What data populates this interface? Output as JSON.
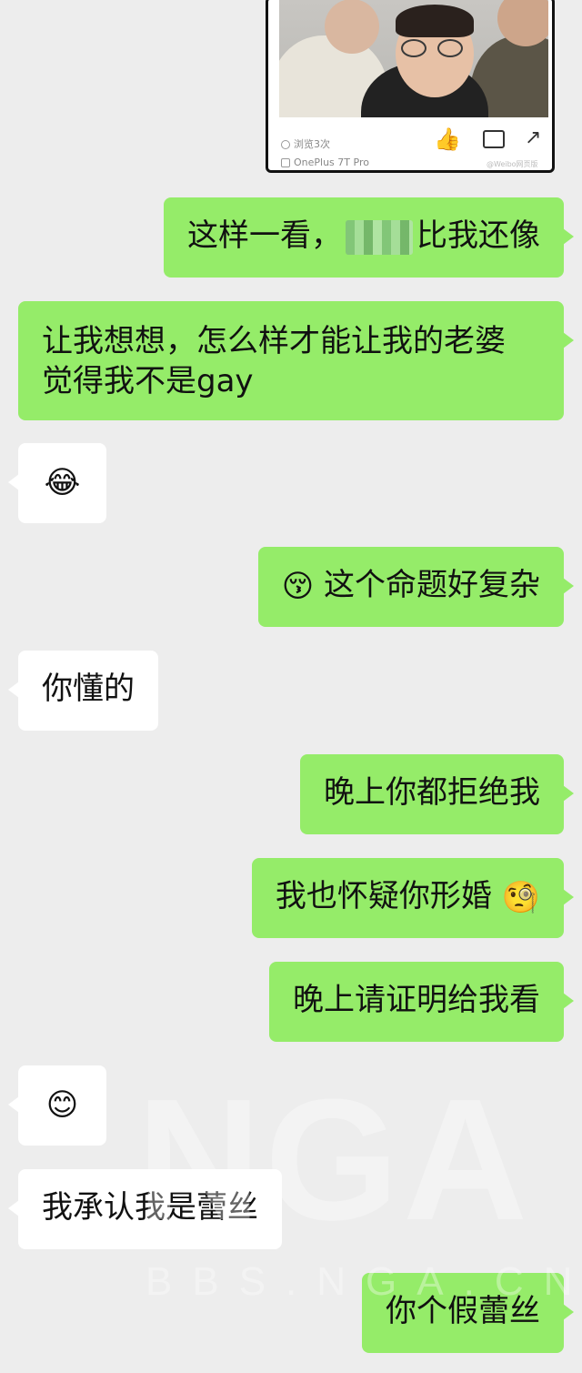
{
  "shared_card": {
    "views_text": "浏览3次",
    "device_text": "OnePlus 7T Pro",
    "watermark_text": "@Weibo网页版"
  },
  "messages": [
    {
      "id": "m1",
      "side": "me",
      "text_before": "这样一看，",
      "redacted": true,
      "text_after": "比我还像"
    },
    {
      "id": "m2",
      "side": "me",
      "line1": "让我想想，怎么样才能让我的老婆",
      "line2": "觉得我不是gay"
    },
    {
      "id": "m3",
      "side": "them",
      "emoji": "😂"
    },
    {
      "id": "m4",
      "side": "me",
      "emoji": "😚",
      "text": "这个命题好复杂"
    },
    {
      "id": "m5",
      "side": "them",
      "text": "你懂的"
    },
    {
      "id": "m6",
      "side": "me",
      "text": "晚上你都拒绝我"
    },
    {
      "id": "m7",
      "side": "me",
      "text": "我也怀疑你形婚",
      "emoji": "🧐"
    },
    {
      "id": "m8",
      "side": "me",
      "text": "晚上请证明给我看"
    },
    {
      "id": "m9",
      "side": "them",
      "emoji": "😊"
    },
    {
      "id": "m10",
      "side": "them",
      "text": "我承认我是蕾丝"
    },
    {
      "id": "m11",
      "side": "me",
      "text": "你个假蕾丝"
    }
  ],
  "watermark": {
    "big": "NGA",
    "small": "BBS.NGA.CN"
  },
  "colors": {
    "background": "#ededed",
    "my_bubble": "#95ec69",
    "their_bubble": "#ffffff",
    "like_icon": "#2f8ef0"
  }
}
